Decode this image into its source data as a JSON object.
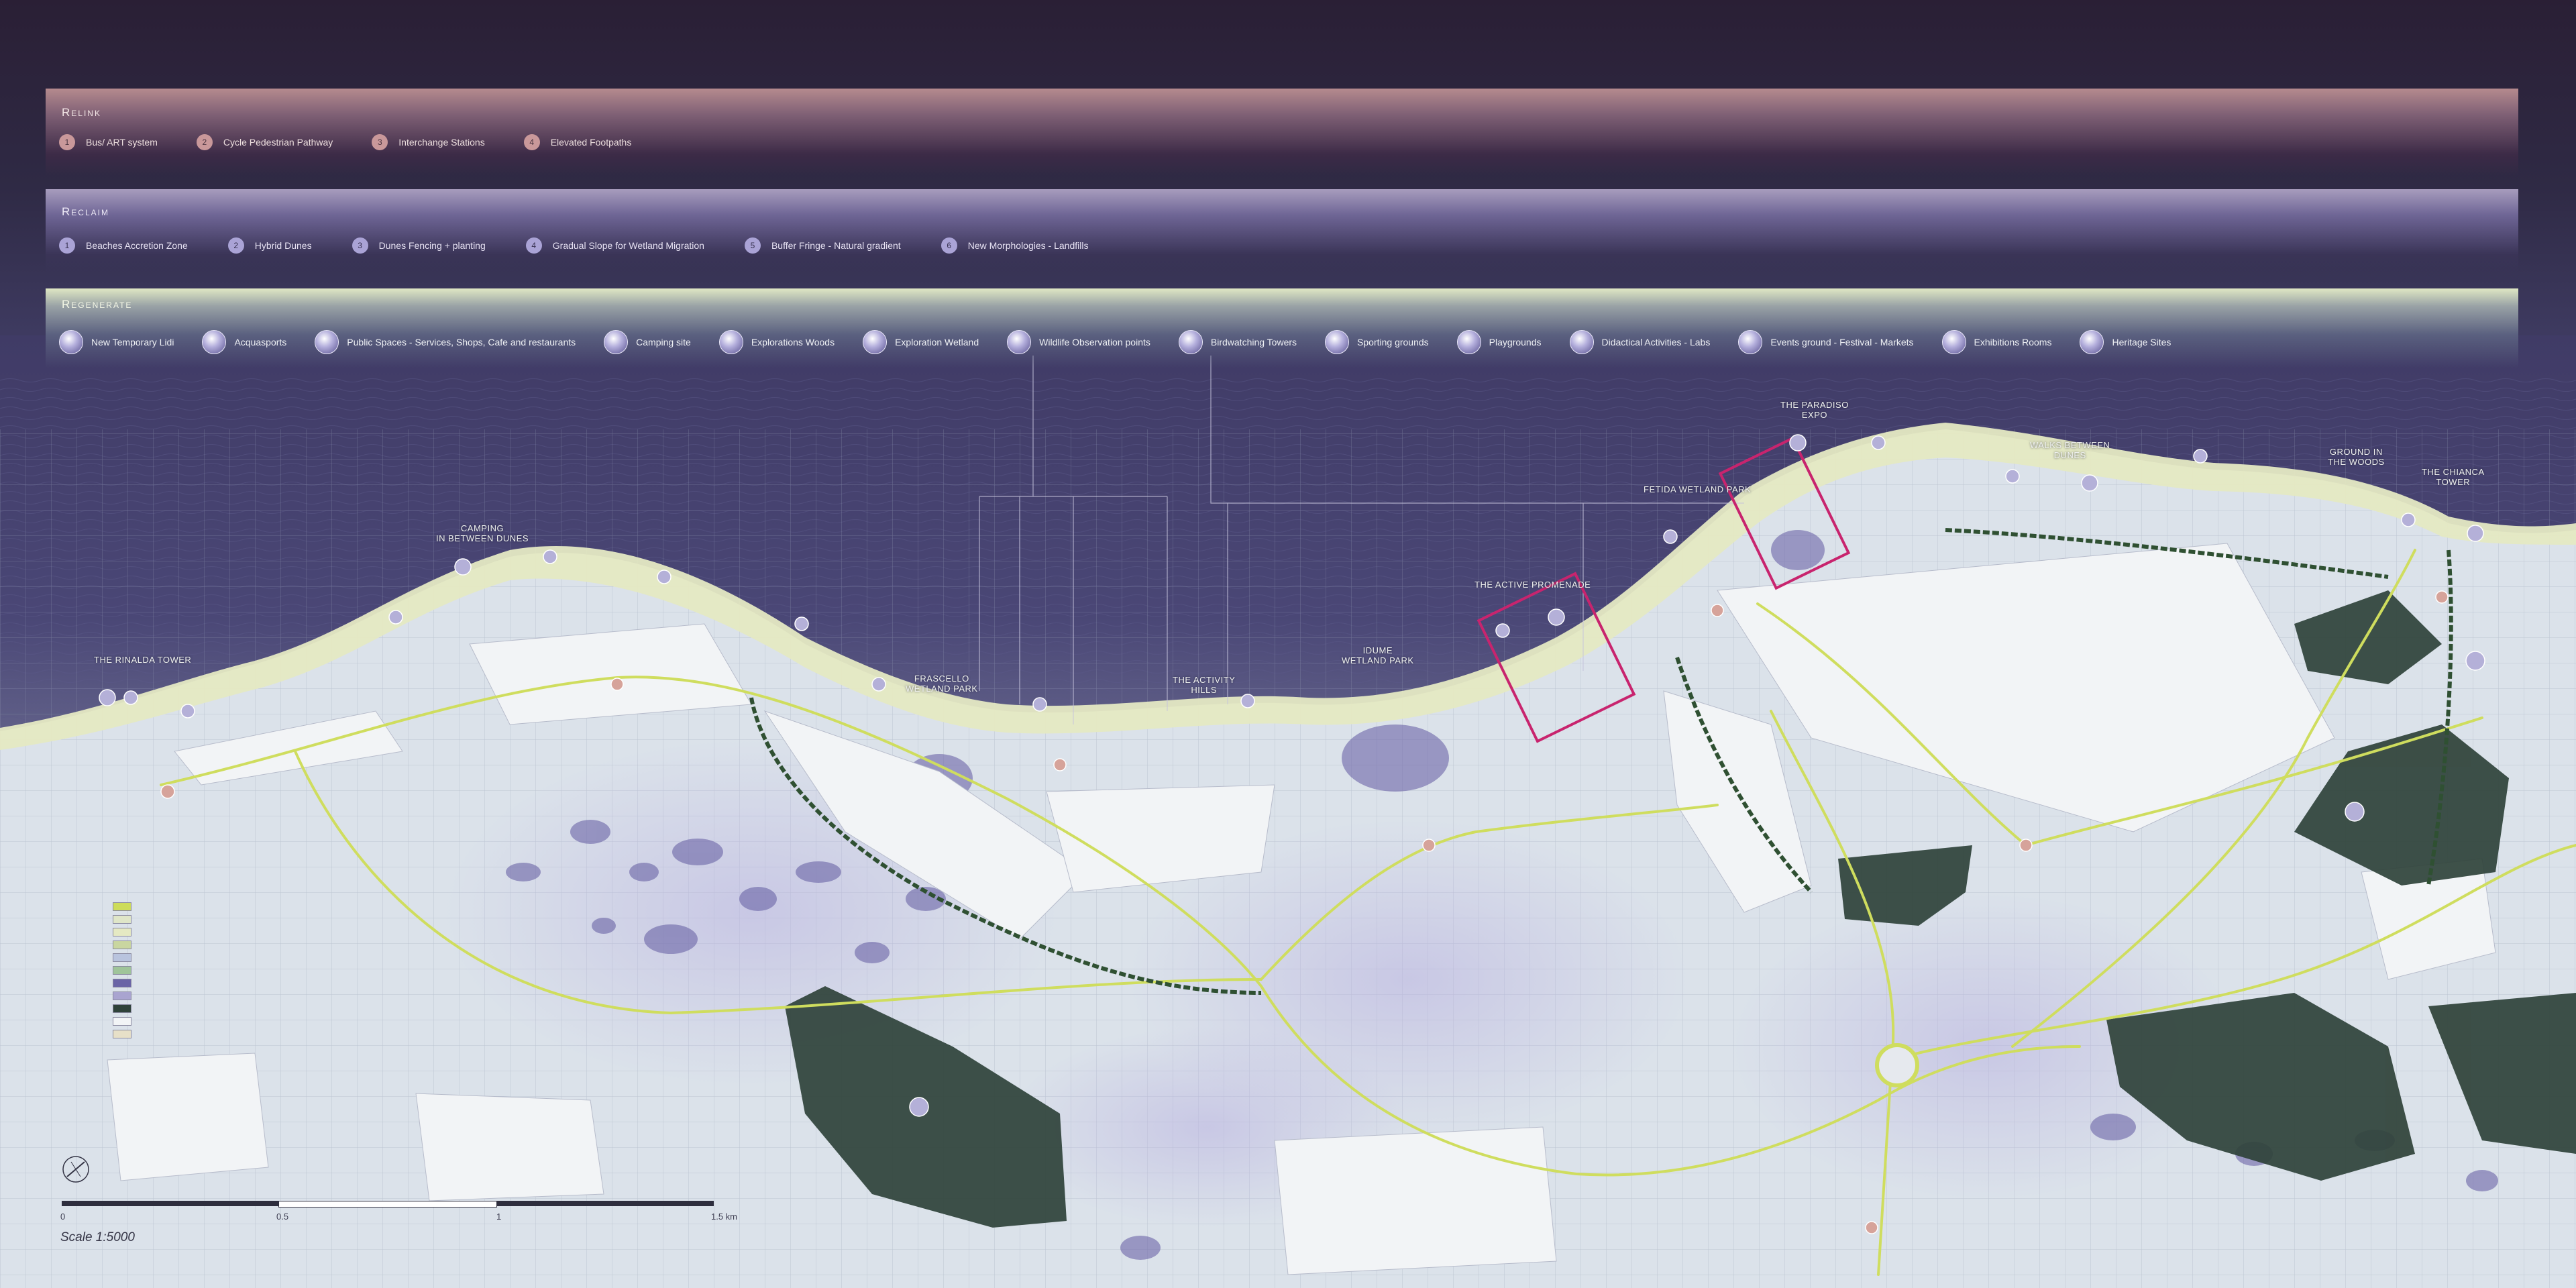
{
  "relink": {
    "title": "Relink",
    "items": [
      {
        "num": "1",
        "label": "Bus/ ART system"
      },
      {
        "num": "2",
        "label": "Cycle Pedestrian Pathway"
      },
      {
        "num": "3",
        "label": "Interchange Stations"
      },
      {
        "num": "4",
        "label": "Elevated Footpaths"
      }
    ]
  },
  "reclaim": {
    "title": "Reclaim",
    "items": [
      {
        "num": "1",
        "label": "Beaches Accretion Zone"
      },
      {
        "num": "2",
        "label": "Hybrid Dunes"
      },
      {
        "num": "3",
        "label": "Dunes Fencing + planting"
      },
      {
        "num": "4",
        "label": "Gradual Slope for Wetland Migration"
      },
      {
        "num": "5",
        "label": "Buffer Fringe - Natural gradient"
      },
      {
        "num": "6",
        "label": "New Morphologies - Landfills"
      }
    ]
  },
  "regenerate": {
    "title": "Regenerate",
    "items": [
      {
        "label": "New Temporary Lidi"
      },
      {
        "label": "Acquasports"
      },
      {
        "label": "Public Spaces - Services, Shops, Cafe and restaurants"
      },
      {
        "label": "Camping site"
      },
      {
        "label": "Explorations Woods"
      },
      {
        "label": "Exploration Wetland"
      },
      {
        "label": "Wildlife Observation points"
      },
      {
        "label": "Birdwatching Towers"
      },
      {
        "label": "Sporting grounds"
      },
      {
        "label": "Playgrounds"
      },
      {
        "label": "Didactical Activities - Labs"
      },
      {
        "label": "Events ground - Festival - Markets"
      },
      {
        "label": "Exhibitions Rooms"
      },
      {
        "label": "Heritage Sites"
      }
    ]
  },
  "map_labels": {
    "rinalda_tower": "THE RINALDA TOWER",
    "camping": "CAMPING\nIN BETWEEN DUNES",
    "frascello": "FRASCELLO\nWETLAND PARK",
    "activity_hills": "THE ACTIVITY\nHILLS",
    "idume": "IDUME\nWETLAND PARK",
    "active_promenade": "THE ACTIVE PROMENADE",
    "fetida": "FETIDA WETLAND PARK",
    "paradiso": "THE PARADISO\nEXPO",
    "walks": "WALKS BETWEEN\nDUNES",
    "ground_woods": "GROUND IN\nTHE WOODS",
    "chianca": "THE CHIANCA\nTOWER"
  },
  "scale": {
    "title": "Scale 1:5000",
    "ticks": [
      "0",
      "0.5",
      "1",
      "1.5 km"
    ]
  },
  "colors": {
    "sea": "#3d3a62",
    "sky": "#2a1f35",
    "land": "#dde3ea",
    "beach": "#e4e8c0",
    "path": "#cddc5a",
    "woods": "#2c3c34",
    "wetland": "#5f5a99",
    "frame": "#c8246e"
  }
}
